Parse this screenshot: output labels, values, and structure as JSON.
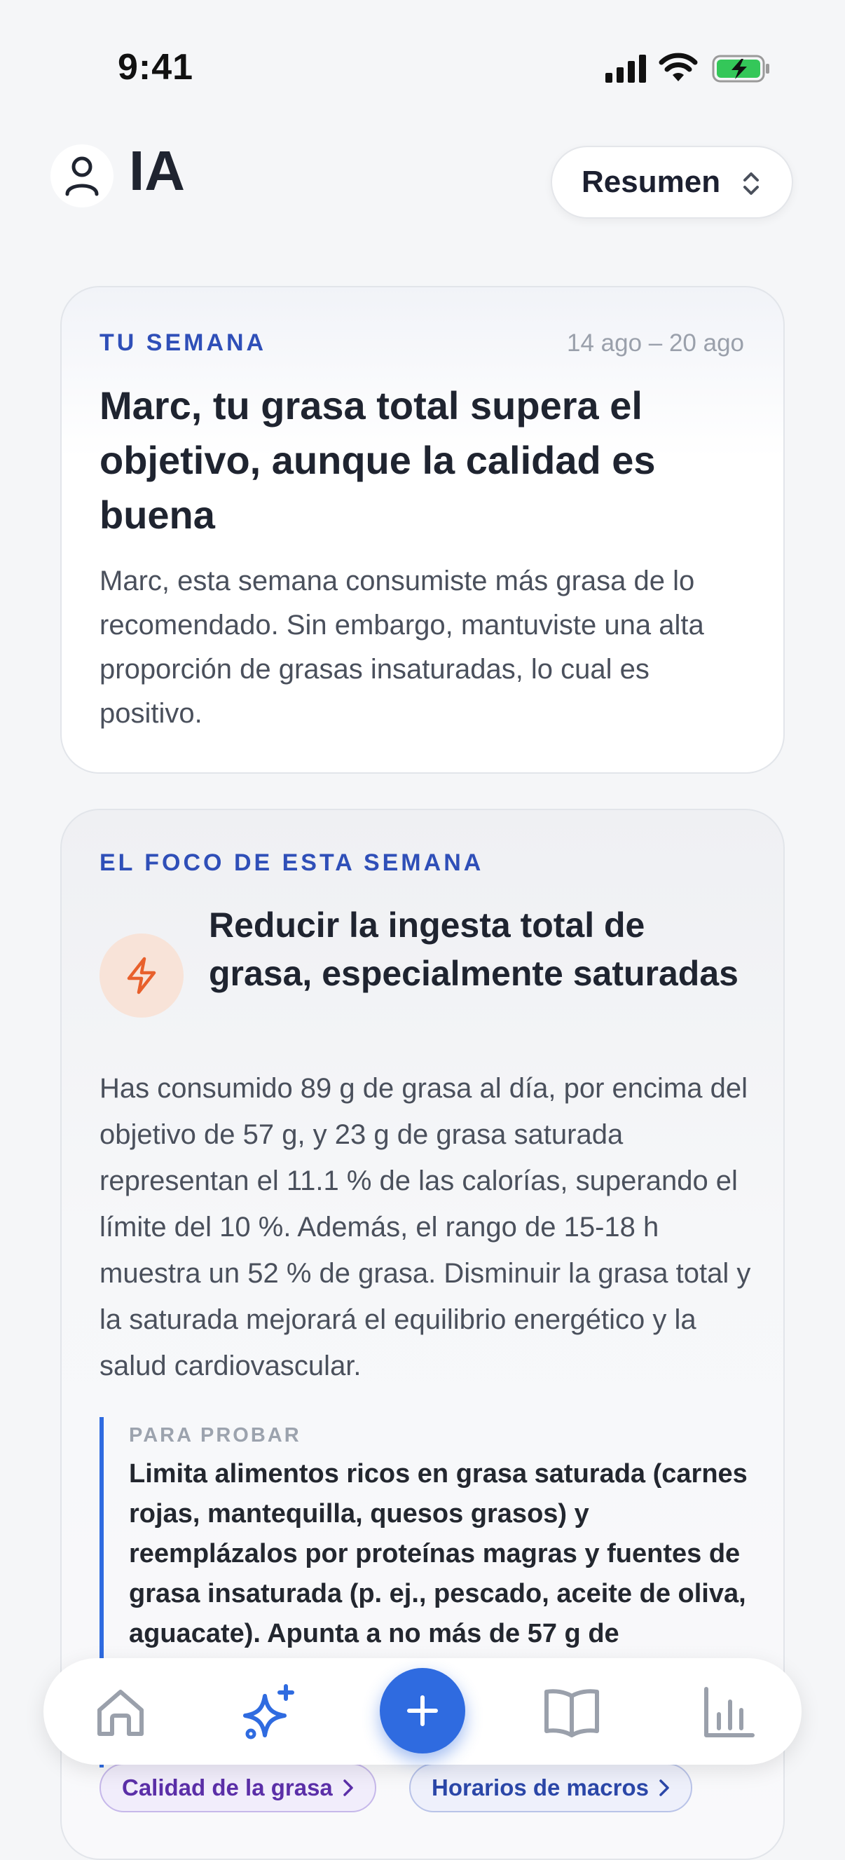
{
  "status_bar": {
    "time": "9:41"
  },
  "header": {
    "title": "IA",
    "period_selector": "Resumen"
  },
  "week_card": {
    "eyebrow": "TU SEMANA",
    "date_range": "14 ago – 20 ago",
    "headline": "Marc, tu grasa total supera el objetivo, aunque la calidad es buena",
    "summary": "Marc, esta semana consumiste más grasa de lo recomendado. Sin embargo, mantuviste una alta proporción de grasas insaturadas, lo cual es positivo."
  },
  "focus_card": {
    "eyebrow": "EL FOCO DE ESTA SEMANA",
    "headline": "Reducir la ingesta total de grasa, especialmente saturadas",
    "body": "Has consumido 89 g de grasa al día, por encima del objetivo de 57 g, y 23 g de grasa saturada representan el 11.1 % de las calorías, superando el límite del 10 %. Además, el rango de 15-18 h muestra un 52 % de grasa. Disminuir la grasa total y la saturada mejorará el equilibrio energético y la salud cardiovascular.",
    "try_label": "PARA PROBAR",
    "try_text": "Limita alimentos ricos en grasa saturada (carnes rojas, mantequilla, quesos grasos) y reemplázalos por proteínas magras y fuentes de grasa insaturada (p. ej., pescado, aceite de oliva, aguacate). Apunta a no más de 57 g de",
    "chips": [
      "Calidad de la grasa",
      "Horarios de macros"
    ]
  },
  "tabbar": {
    "icons": [
      "home-icon",
      "sparkles-icon",
      "plus-icon",
      "book-icon",
      "bar-chart-icon"
    ],
    "accent": "#2f6be0"
  }
}
